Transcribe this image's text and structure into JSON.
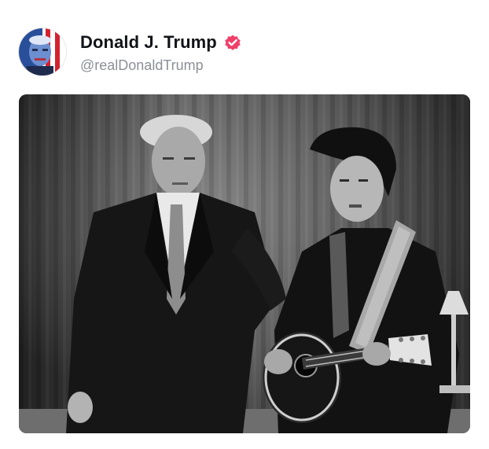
{
  "post": {
    "author": {
      "display_name": "Donald J. Trump",
      "handle": "@realDonaldTrump",
      "verified": true,
      "avatar_icon": "avatar-portrait-flag",
      "verified_icon": "verified-badge-icon"
    },
    "media": {
      "kind": "photo",
      "style": "black-and-white"
    }
  },
  "colors": {
    "name_text": "#111418",
    "handle_text": "#8b9097",
    "verified_badge": "#f0406a",
    "background": "#ffffff"
  }
}
